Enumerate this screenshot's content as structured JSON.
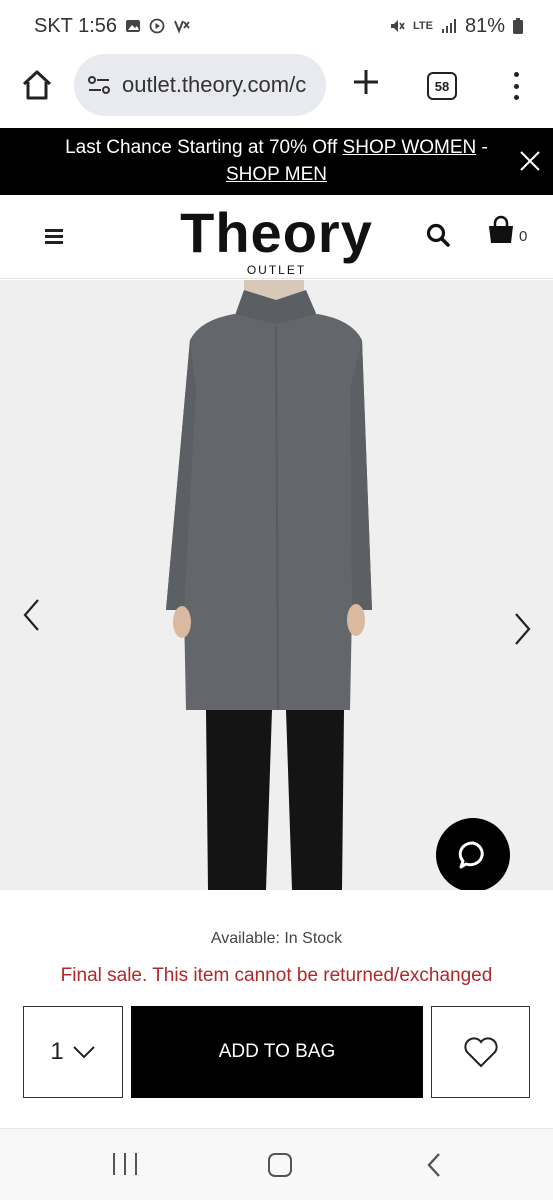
{
  "status_bar": {
    "carrier_time": "SKT 1:56",
    "network": "LTE",
    "battery": "81%"
  },
  "browser": {
    "url": "outlet.theory.com/c",
    "tab_count": "58"
  },
  "promo": {
    "text": "Last Chance Starting at 70% Off",
    "link_women": "SHOP WOMEN",
    "separator": "-",
    "link_men": "SHOP MEN"
  },
  "header": {
    "logo": "Theory",
    "logo_sub": "OUTLET",
    "bag_count": "0"
  },
  "product": {
    "availability": "Available: In Stock",
    "final_sale": "Final sale. This item cannot be returned/exchanged",
    "quantity": "1",
    "add_to_bag": "ADD TO BAG"
  },
  "colors": {
    "promo_bg": "#000000",
    "sale_red": "#b3262b",
    "coat_gray": "#63666b"
  },
  "icons": [
    "home-icon",
    "site-info-icon",
    "plus-icon",
    "tabs-icon",
    "more-icon",
    "close-icon",
    "menu-icon",
    "search-icon",
    "bag-icon",
    "chevron-left-icon",
    "chevron-right-icon",
    "chat-icon",
    "chevron-down-icon",
    "heart-icon"
  ]
}
